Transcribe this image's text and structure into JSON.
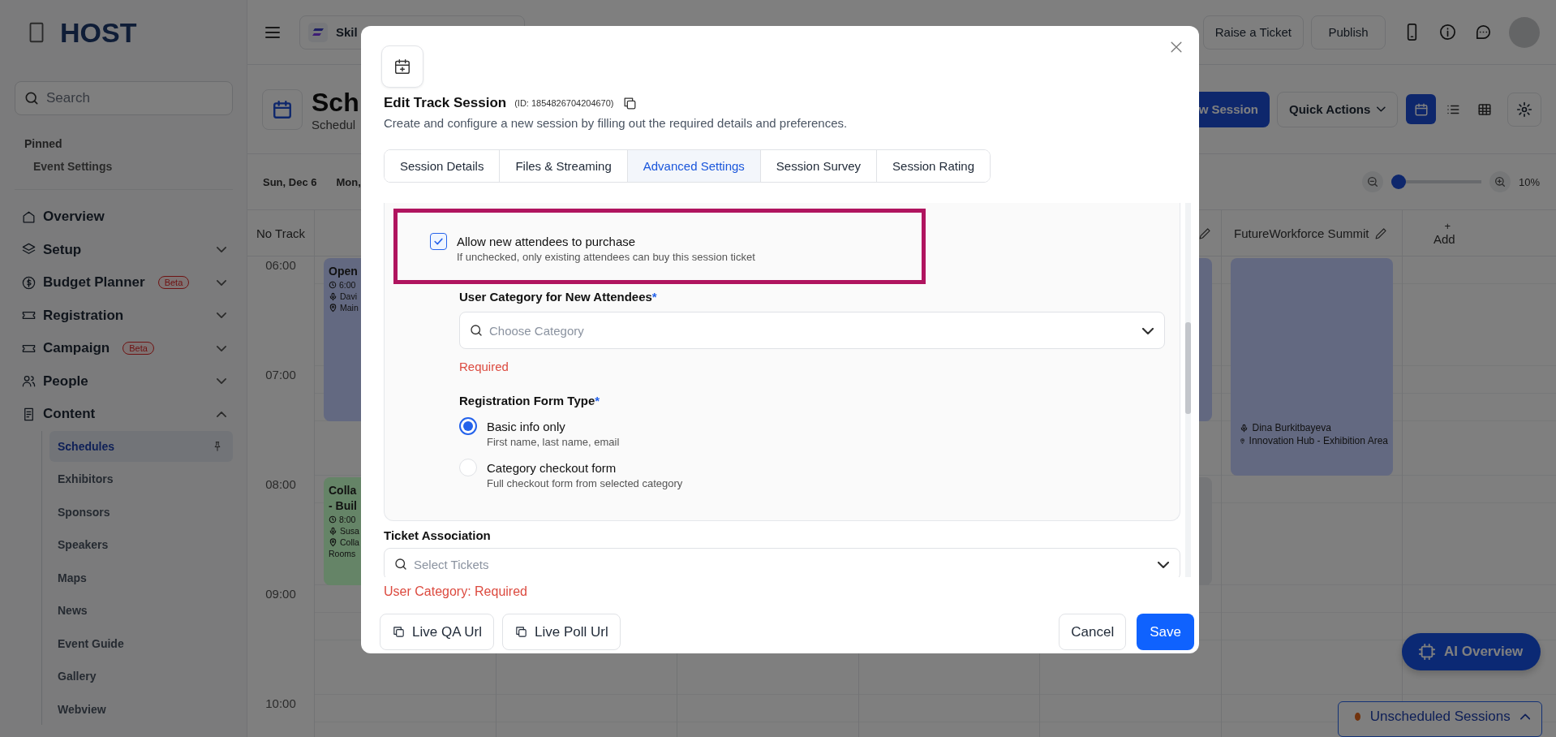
{
  "sidebar": {
    "logo": "HOST",
    "search": {
      "placeholder": "Search"
    },
    "pinned_heading": "Pinned",
    "pinned": [
      {
        "label": "Event Settings"
      }
    ],
    "nav": [
      {
        "label": "Overview"
      },
      {
        "label": "Setup",
        "expanded": false
      },
      {
        "label": "Budget Planner",
        "badge": "Beta",
        "expanded": false
      },
      {
        "label": "Registration",
        "expanded": false
      },
      {
        "label": "Campaign",
        "badge": "Beta",
        "expanded": false
      },
      {
        "label": "People",
        "expanded": false
      },
      {
        "label": "Content",
        "expanded": true,
        "children": [
          {
            "label": "Schedules",
            "selected": true
          },
          {
            "label": "Exhibitors",
            "selected": false
          },
          {
            "label": "Sponsors",
            "selected": false
          },
          {
            "label": "Speakers",
            "selected": false
          },
          {
            "label": "Maps",
            "selected": false
          },
          {
            "label": "News",
            "selected": false
          },
          {
            "label": "Event Guide",
            "selected": false
          },
          {
            "label": "Gallery",
            "selected": false
          },
          {
            "label": "Webview",
            "selected": false
          }
        ]
      }
    ]
  },
  "topbar": {
    "org": "Skil",
    "raise_ticket": "Raise a Ticket",
    "publish": "Publish"
  },
  "header": {
    "title": "Sch",
    "subtitle": "Schedul",
    "new_session": "w Session",
    "quick_actions": "Quick Actions",
    "views": [
      {
        "selected": true
      },
      {
        "selected": false
      },
      {
        "selected": false
      }
    ]
  },
  "dates": [
    {
      "label": "Sun, Dec 6"
    },
    {
      "label": "Mon,"
    }
  ],
  "zoom": {
    "level": 0,
    "reading": "10%"
  },
  "calendar": {
    "corner": "No Track",
    "hours": [
      "06:00",
      "07:00",
      "08:00",
      "09:00",
      "10:00"
    ],
    "tracks": [
      {
        "events": [
          {
            "color": "#636981",
            "title": [
              "Open"
            ],
            "time": "6:00",
            "speaker": "Davi",
            "location": [
              "Main"
            ]
          },
          {
            "color": "#658467",
            "title": [
              "Colla",
              "- Buil"
            ],
            "time": "8:00",
            "speaker": "Susa",
            "location": [
              "Colla",
              "Rooms"
            ]
          }
        ]
      },
      {
        "editable": true,
        "events": [
          {
            "color": "#626880"
          },
          {
            "color": "#757678"
          }
        ]
      },
      {
        "name": "FutureWorkforce Summit",
        "editable": true,
        "events": [
          {
            "color": "#636981",
            "speaker": "Dina Burkitbayeva",
            "location": [
              "Innovation Hub - Exhibition Area"
            ]
          }
        ]
      }
    ],
    "add": {
      "icon": "+",
      "label": "Add"
    }
  },
  "modal": {
    "title": "Edit Track Session",
    "id": "(ID: 1854826704204670)",
    "subtitle": "Create and configure a new session by filling out the required details and preferences.",
    "tabs": [
      {
        "label": "Session Details",
        "selected": false
      },
      {
        "label": "Files & Streaming",
        "selected": false
      },
      {
        "label": "Advanced Settings",
        "selected": true
      },
      {
        "label": "Session Survey",
        "selected": false
      },
      {
        "label": "Session Rating",
        "selected": false
      }
    ],
    "allow_purchase": {
      "label": "Allow new attendees to purchase",
      "hint": "If unchecked, only existing attendees can buy this session ticket",
      "checked": true,
      "highlighted": true
    },
    "user_category": {
      "label": "User Category for New Attendees",
      "mark": "*",
      "placeholder": "Choose Category",
      "error": "Required"
    },
    "form_type": {
      "label": "Registration Form Type",
      "mark": "*",
      "options": [
        {
          "label": "Basic info only",
          "hint": "First name, last name, email",
          "selected": true
        },
        {
          "label": "Category checkout form",
          "hint": "Full checkout form from selected category",
          "selected": false
        }
      ]
    },
    "ticket_association": {
      "label": "Ticket Association",
      "placeholder": "Select Tickets"
    },
    "form_error": "User Category: Required",
    "buttons": {
      "live_qa": "Live QA Url",
      "live_poll": "Live Poll Url",
      "cancel": "Cancel",
      "save": "Save"
    }
  },
  "ai_overview": "AI Overview",
  "unscheduled": "Unscheduled Sessions"
}
